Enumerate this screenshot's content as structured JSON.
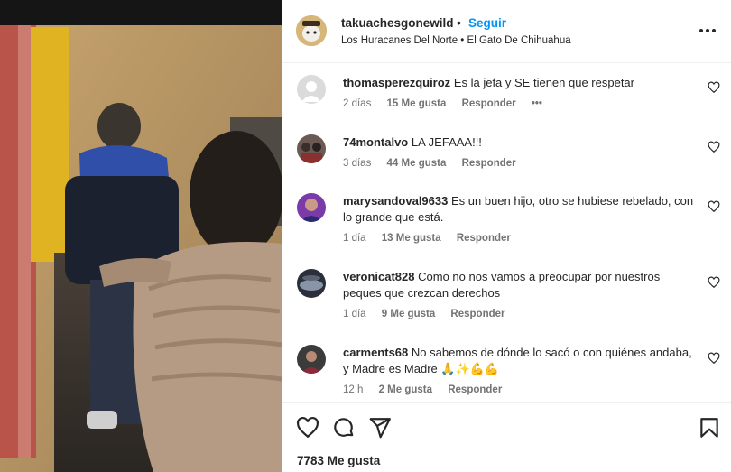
{
  "post": {
    "username": "takuachesgonewild",
    "separator": "•",
    "follow_label": "Seguir",
    "audio": "Los Huracanes Del Norte • El Gato De Chihuahua",
    "likes": "7783 Me gusta"
  },
  "comments": [
    {
      "user": "thomasperezquiroz",
      "text": "Es la jefa y SE tienen que respetar",
      "time": "2 días",
      "likes": "15 Me gusta",
      "reply": "Responder",
      "more": "•••"
    },
    {
      "user": "74montalvo",
      "text": "LA JEFAAA!!!",
      "time": "3 días",
      "likes": "44 Me gusta",
      "reply": "Responder"
    },
    {
      "user": "marysandoval9633",
      "text": "Es un buen hijo, otro se hubiese rebelado, con lo grande que está.",
      "time": "1 día",
      "likes": "13 Me gusta",
      "reply": "Responder"
    },
    {
      "user": "veronicat828",
      "text": "Como no nos vamos a preocupar por nuestros peques que crezcan derechos",
      "time": "1 día",
      "likes": "9 Me gusta",
      "reply": "Responder"
    },
    {
      "user": "carments68",
      "text": "No sabemos de dónde lo sacó o con quiénes andaba, y Madre es Madre 🙏✨💪💪",
      "time": "12 h",
      "likes": "2 Me gusta",
      "reply": "Responder"
    }
  ],
  "icons": {
    "more": "more-options-icon",
    "like": "heart-icon",
    "comment": "comment-icon",
    "share": "paper-plane-icon",
    "save": "bookmark-icon"
  },
  "colors": {
    "link": "#0095f6",
    "text": "#262626",
    "muted": "#737373",
    "divider": "#efefef"
  }
}
